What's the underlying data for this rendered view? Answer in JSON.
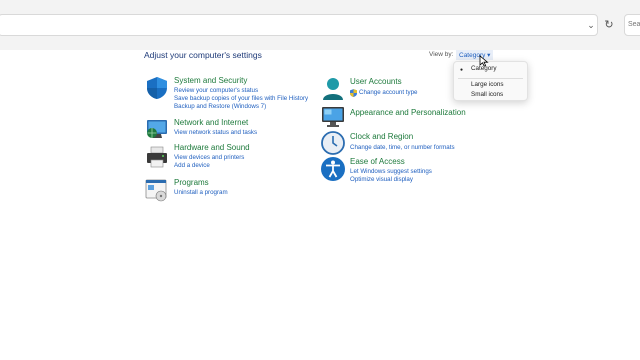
{
  "toolbar": {
    "search_placeholder": "Sea"
  },
  "main": {
    "heading": "Adjust your computer's settings",
    "view_by_label": "View by:",
    "view_by_value": "Category ▾",
    "view_menu": {
      "items": [
        "Category",
        "Large icons",
        "Small icons"
      ],
      "selected": "Category"
    }
  },
  "categories": {
    "system_security": {
      "title": "System and Security",
      "links": [
        "Review your computer's status",
        "Save backup copies of your files with File History",
        "Backup and Restore (Windows 7)"
      ]
    },
    "network": {
      "title": "Network and Internet",
      "links": [
        "View network status and tasks"
      ]
    },
    "hardware": {
      "title": "Hardware and Sound",
      "links": [
        "View devices and printers",
        "Add a device"
      ]
    },
    "programs": {
      "title": "Programs",
      "links": [
        "Uninstall a program"
      ]
    },
    "user_accounts": {
      "title": "User Accounts",
      "links": [
        "Change account type"
      ]
    },
    "appearance": {
      "title": "Appearance and Personalization",
      "links": []
    },
    "clock": {
      "title": "Clock and Region",
      "links": [
        "Change date, time, or number formats"
      ]
    },
    "ease": {
      "title": "Ease of Access",
      "links": [
        "Let Windows suggest settings",
        "Optimize visual display"
      ]
    }
  },
  "colors": {
    "title_green": "#1e7a3c",
    "link_blue": "#1f5fbf",
    "heading_blue": "#1e3a78"
  }
}
